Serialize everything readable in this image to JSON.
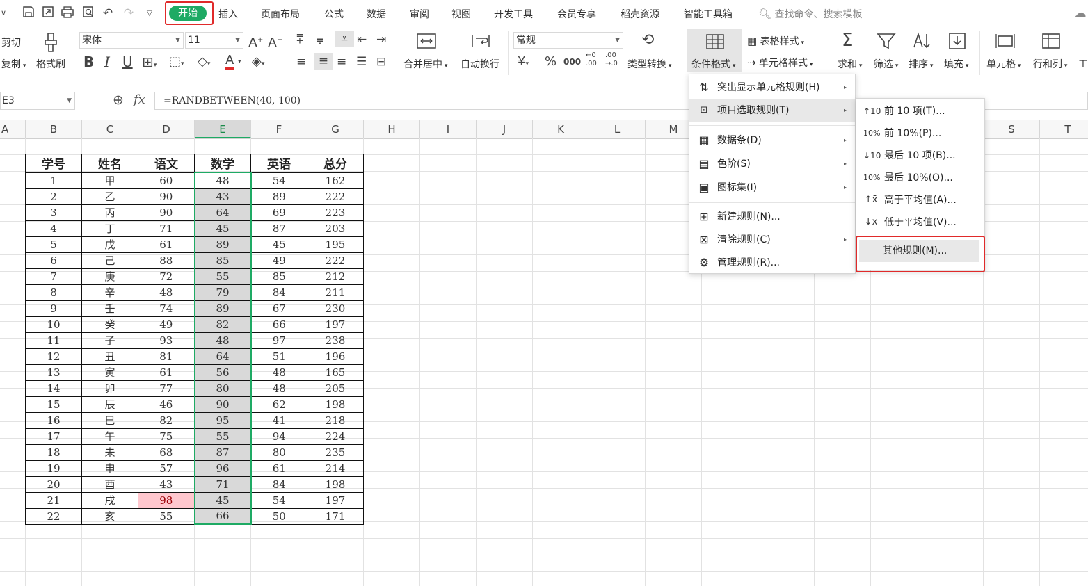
{
  "quick_access": {
    "icons": [
      "save-icon",
      "export-icon",
      "print-icon",
      "print-preview-icon",
      "undo-icon",
      "redo-icon",
      "customize-icon"
    ]
  },
  "tabs": {
    "home": "开始",
    "insert": "插入",
    "page_layout": "页面布局",
    "formulas": "公式",
    "data": "数据",
    "review": "审阅",
    "view": "视图",
    "developer": "开发工具",
    "member": "会员专享",
    "resources": "稻壳资源",
    "smart_tools": "智能工具箱",
    "search_placeholder": "查找命令、搜索模板"
  },
  "ribbon": {
    "cut": "剪切",
    "copy": "复制",
    "format_painter": "格式刷",
    "font_name": "宋体",
    "font_size": "11",
    "merge_center": "合并居中",
    "wrap_text": "自动换行",
    "number_format": "常规",
    "type_convert": "类型转换",
    "conditional_format": "条件格式",
    "table_style": "表格样式",
    "cell_style": "单元格样式",
    "sum": "求和",
    "filter": "筛选",
    "sort": "排序",
    "fill": "填充",
    "cells": "单元格",
    "row_col": "行和列",
    "worksheet_partial": "工"
  },
  "formula_bar": {
    "name_box": "E3",
    "fx": "fx",
    "formula": "=RANDBETWEEN(40, 100)"
  },
  "columns": [
    "B",
    "C",
    "D",
    "E",
    "F",
    "G",
    "H",
    "I",
    "J",
    "K",
    "L",
    "M",
    "S",
    "T"
  ],
  "table": {
    "headers": [
      "学号",
      "姓名",
      "语文",
      "数学",
      "英语",
      "总分"
    ],
    "rows": [
      [
        "1",
        "甲",
        "60",
        "48",
        "54",
        "162"
      ],
      [
        "2",
        "乙",
        "90",
        "43",
        "89",
        "222"
      ],
      [
        "3",
        "丙",
        "90",
        "64",
        "69",
        "223"
      ],
      [
        "4",
        "丁",
        "71",
        "45",
        "87",
        "203"
      ],
      [
        "5",
        "戊",
        "61",
        "89",
        "45",
        "195"
      ],
      [
        "6",
        "己",
        "88",
        "85",
        "49",
        "222"
      ],
      [
        "7",
        "庚",
        "72",
        "55",
        "85",
        "212"
      ],
      [
        "8",
        "辛",
        "48",
        "79",
        "84",
        "211"
      ],
      [
        "9",
        "壬",
        "74",
        "89",
        "67",
        "230"
      ],
      [
        "10",
        "癸",
        "49",
        "82",
        "66",
        "197"
      ],
      [
        "11",
        "子",
        "93",
        "48",
        "97",
        "238"
      ],
      [
        "12",
        "丑",
        "81",
        "64",
        "51",
        "196"
      ],
      [
        "13",
        "寅",
        "61",
        "56",
        "48",
        "165"
      ],
      [
        "14",
        "卯",
        "77",
        "80",
        "48",
        "205"
      ],
      [
        "15",
        "辰",
        "46",
        "90",
        "62",
        "198"
      ],
      [
        "16",
        "巳",
        "82",
        "95",
        "41",
        "218"
      ],
      [
        "17",
        "午",
        "75",
        "55",
        "94",
        "224"
      ],
      [
        "18",
        "未",
        "68",
        "87",
        "80",
        "235"
      ],
      [
        "19",
        "申",
        "57",
        "96",
        "61",
        "214"
      ],
      [
        "20",
        "酉",
        "43",
        "71",
        "84",
        "198"
      ],
      [
        "21",
        "戌",
        "98",
        "45",
        "54",
        "197"
      ],
      [
        "22",
        "亥",
        "55",
        "66",
        "50",
        "171"
      ]
    ]
  },
  "cond_menu": {
    "items": [
      {
        "label": "突出显示单元格规则(H)",
        "icon": "highlight-rules-icon"
      },
      {
        "label": "项目选取规则(T)",
        "icon": "top-bottom-rules-icon"
      },
      {
        "label": "数据条(D)",
        "icon": "data-bars-icon"
      },
      {
        "label": "色阶(S)",
        "icon": "color-scale-icon"
      },
      {
        "label": "图标集(I)",
        "icon": "icon-sets-icon"
      },
      {
        "label": "新建规则(N)...",
        "icon": "new-rule-icon"
      },
      {
        "label": "清除规则(C)",
        "icon": "clear-rules-icon"
      },
      {
        "label": "管理规则(R)...",
        "icon": "manage-rules-icon"
      }
    ]
  },
  "topn_menu": {
    "items": [
      {
        "label": "前 10 项(T)...",
        "icon": "top-10-icon"
      },
      {
        "label": "前 10%(P)...",
        "icon": "top-10-percent-icon"
      },
      {
        "label": "最后 10 项(B)...",
        "icon": "bottom-10-icon"
      },
      {
        "label": "最后 10%(O)...",
        "icon": "bottom-10-percent-icon"
      },
      {
        "label": "高于平均值(A)...",
        "icon": "above-average-icon"
      },
      {
        "label": "低于平均值(V)...",
        "icon": "below-average-icon"
      },
      {
        "label": "其他规则(M)...",
        "icon": ""
      }
    ]
  },
  "colors": {
    "accent": "#1eaa64",
    "highlight_box": "#e02a2a",
    "conditional_fill": "#ffc7ce",
    "conditional_text": "#9c0006"
  }
}
